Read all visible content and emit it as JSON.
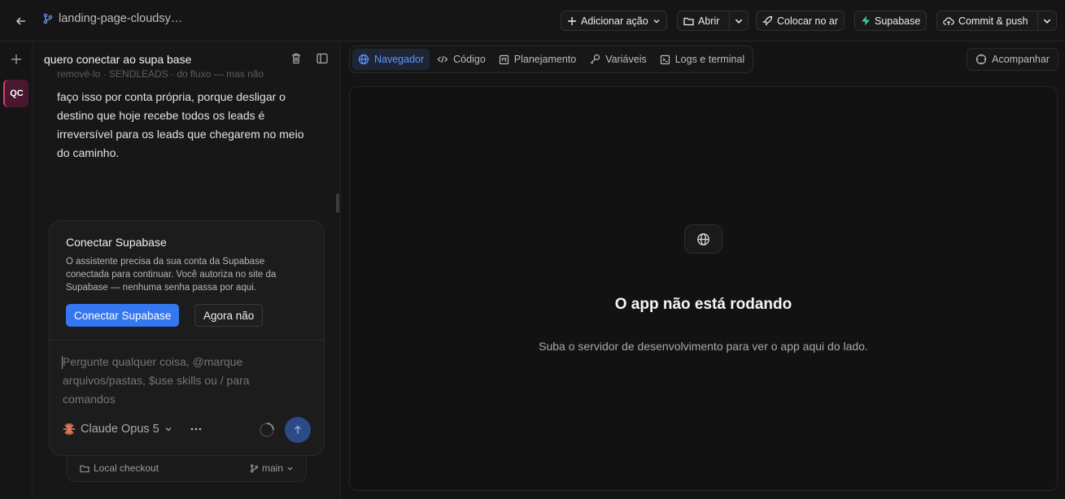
{
  "topbar": {
    "project_name": "landing-page-cloudsy…",
    "add_action_label": "Adicionar ação",
    "open_label": "Abrir",
    "deploy_label": "Colocar no ar",
    "supabase_label": "Supabase",
    "commit_push_label": "Commit & push"
  },
  "rail": {
    "avatar_initials": "QC"
  },
  "chat": {
    "title": "quero conectar ao supa base",
    "message_faded": "removê-lo · SENDLEADS · do fluxo — mas não",
    "message": "faço isso por conta própria, porque desligar o destino que hoje recebe todos os leads é irreversível para os leads que chegarem no meio do caminho.",
    "connect_card": {
      "title": "Conectar Supabase",
      "description": "O assistente precisa da sua conta da Supabase conectada para continuar. Você autoriza no site da Supabase — nenhuma senha passa por aqui.",
      "primary_button": "Conectar Supabase",
      "secondary_button": "Agora não"
    },
    "input_placeholder": "Pergunte qualquer coisa, @marque arquivos/pastas, $use skills ou / para comandos",
    "model_name": "Claude Opus 5",
    "checkout_label": "Local checkout",
    "branch_label": "main"
  },
  "right": {
    "tabs": [
      {
        "label": "Navegador"
      },
      {
        "label": "Código"
      },
      {
        "label": "Planejamento"
      },
      {
        "label": "Variáveis"
      },
      {
        "label": "Logs e terminal"
      }
    ],
    "follow_label": "Acompanhar",
    "empty_title": "O app não está rodando",
    "empty_subtitle": "Suba o servidor de desenvolvimento para ver o app aqui do lado."
  },
  "colors": {
    "accent": "#3577f0",
    "active_tab_text": "#5f97ff",
    "supabase_green": "#3ecf8e",
    "avatar_bg": "#4a1730",
    "claude_orange": "#d97757"
  },
  "icons": [
    "arrow-left-icon",
    "branch-icon",
    "plus-icon",
    "folder-icon",
    "chevron-down-icon",
    "rocket-icon",
    "supabase-bolt-icon",
    "cloud-upload-icon",
    "trash-icon",
    "sidebar-toggle-icon",
    "globe-icon",
    "code-icon",
    "kanban-icon",
    "key-icon",
    "terminal-icon",
    "target-icon",
    "claude-spark-icon",
    "more-icon",
    "spinner-icon",
    "arrow-up-icon",
    "git-branch-icon"
  ]
}
